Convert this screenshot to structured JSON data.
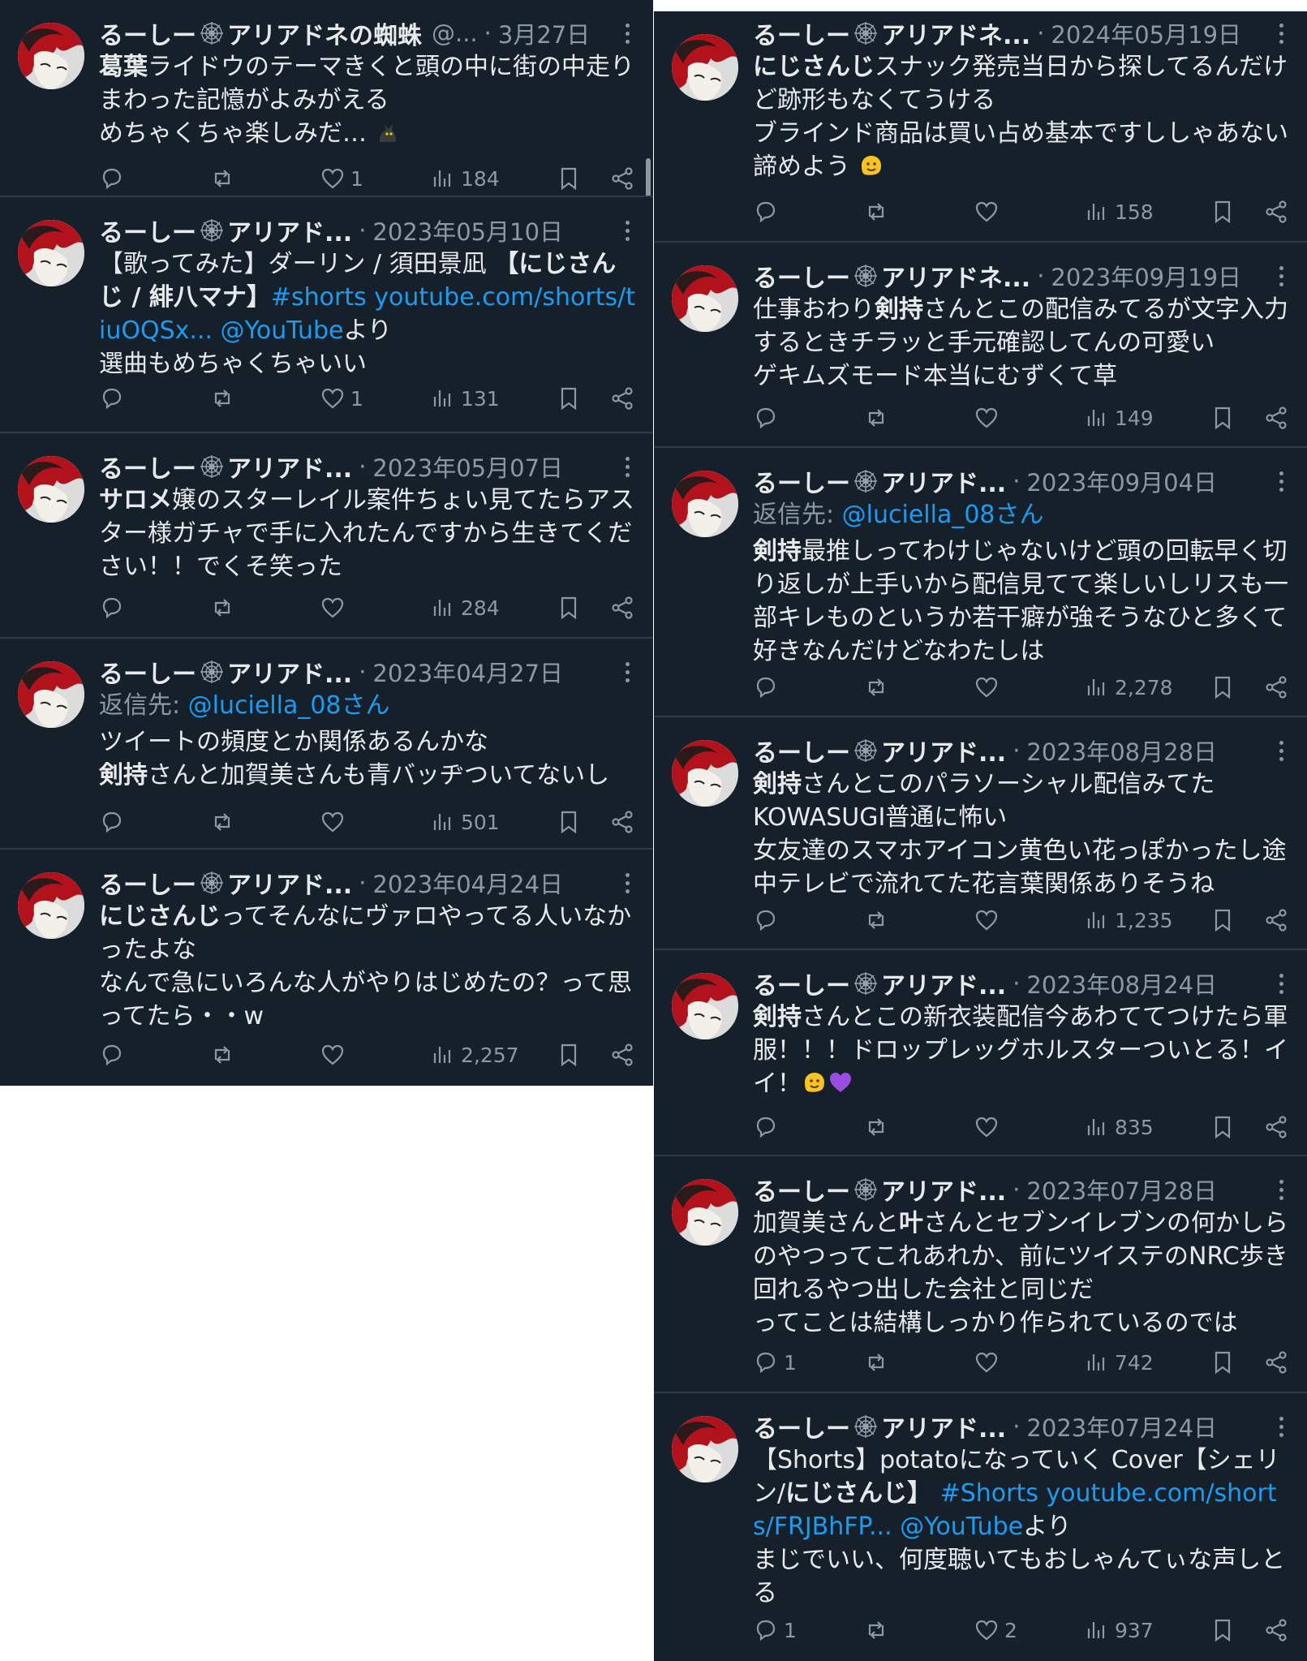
{
  "user_display": "るーし ー🕸アリアドネの蜘蛛",
  "left_column": [
    {
      "name": "るーしー",
      "name_suffix": "アリアドネの蜘蛛",
      "handle": "@...",
      "date": "3月27日",
      "text_bold": "葛葉",
      "text": "ライドウのテーマきくと頭の中に街の中走りまわった記憶がよみがえる\nめちゃくちゃ楽しみだ…",
      "replies": "",
      "likes": "1",
      "views": "184"
    },
    {
      "name": "るーしー",
      "name_suffix": "アリアド...",
      "date": "2023年05月10日",
      "text_pre": "【歌ってみた】ダーリン / 須田景凪 ",
      "text_bold": "【にじさんじ",
      "text_mid": " / 緋八マナ】",
      "link1": "#shorts youtube.com/shorts/tiuOQSx...",
      "link2": " @YouTube",
      "text_post": "より\n選曲もめちゃくちゃいい",
      "likes": "1",
      "views": "131"
    },
    {
      "name": "るーしー",
      "name_suffix": "アリアド...",
      "date": "2023年05月07日",
      "text_bold": "サロメ",
      "text": "嬢のスターレイル案件ちょい見てたらアスター様ガチャで手に入れたんですから生きてください！！でくそ笑った",
      "views": "284"
    },
    {
      "name": "るーしー",
      "name_suffix": "アリアド...",
      "date": "2023年04月27日",
      "reply_to_label": "返信先: ",
      "reply_to_user": "@luciella_08さん",
      "text_line1": "ツイートの頻度とか関係あるんかな",
      "text_bold": "剣持",
      "text": "さんと加賀美さんも青バッヂついてないし",
      "views": "501"
    },
    {
      "name": "るーしー",
      "name_suffix": "アリアド...",
      "date": "2023年04月24日",
      "text_bold": "にじさんじ",
      "text": "ってそんなにヴァロやってる人いなかったよな\nなんで急にいろんな人がやりはじめたの？って思ってたら・・w",
      "views": "2,257"
    }
  ],
  "right_column": [
    {
      "name": "るーしー",
      "name_suffix": "アリアドネ...",
      "date": "2024年05月19日",
      "text_bold": "にじさんじ",
      "text": "スナック発売当日から探してるんだけど跡形もなくてうける\nブラインド商品は買い占め基本ですししゃあない諦めよう",
      "views": "158"
    },
    {
      "name": "るーしー",
      "name_suffix": "アリアドネ...",
      "date": "2023年09月19日",
      "text_pre": "仕事おわり",
      "text_bold": "剣持",
      "text": "さんとこの配信みてるが文字入力するときチラッと手元確認してんの可愛い\nゲキムズモード本当にむずくて草",
      "views": "149"
    },
    {
      "name": "るーしー",
      "name_suffix": "アリアド...",
      "date": "2023年09月04日",
      "reply_to_label": "返信先: ",
      "reply_to_user": "@luciella_08さん",
      "text_bold": "剣持",
      "text": "最推しってわけじゃないけど頭の回転早く切り返しが上手いから配信見てて楽しいしリスも一部キレものというか若干癖が強そうなひと多くて好きなんだけどなわたしは",
      "views": "2,278"
    },
    {
      "name": "るーしー",
      "name_suffix": "アリアド...",
      "date": "2023年08月28日",
      "text_bold": "剣持",
      "text": "さんとこのパラソーシャル配信みてた\nKOWASUGI普通に怖い\n女友達のスマホアイコン黄色い花っぽかったし途中テレビで流れてた花言葉関係ありそうね",
      "views": "1,235"
    },
    {
      "name": "るーしー",
      "name_suffix": "アリアド...",
      "date": "2023年08月24日",
      "text_bold": "剣持",
      "text": "さんとこの新衣装配信今あわててつけたら軍服！！！ドロップレッグホルスターついとる！イイ！",
      "views": "835"
    },
    {
      "name": "るーしー",
      "name_suffix": "アリアド...",
      "date": "2023年07月28日",
      "text_pre": "加賀美さんと",
      "text_bold": "叶",
      "text": "さんとセブンイレブンの何かしらのやつってこれあれか、前にツイステのNRC歩き回れるやつ出した会社と同じだ\nってことは結構しっかり作られているのでは",
      "replies": "1",
      "views": "742"
    },
    {
      "name": "るーしー",
      "name_suffix": "アリアド...",
      "date": "2023年07月24日",
      "text_pre": "【Shorts】potatoになっていく Cover【シェリン/",
      "text_bold": "にじさんじ",
      "text_mid": "】 ",
      "link1": "#Shorts youtube.com/shorts/FRJBhFP...",
      "link2": " @YouTube",
      "text_post": "より\nまじでいい、何度聴いてもおしゃんてぃな声しとる",
      "replies": "1",
      "likes": "2",
      "views": "937"
    }
  ]
}
